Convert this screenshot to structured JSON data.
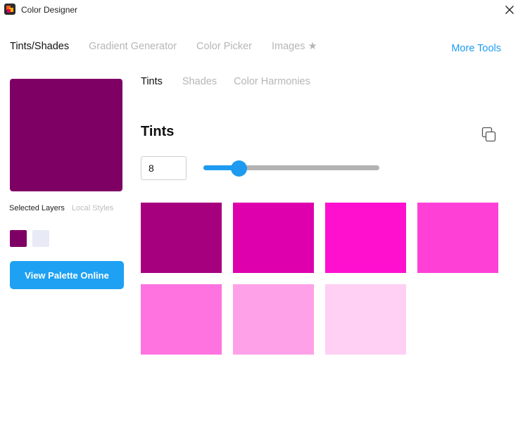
{
  "window": {
    "title": "Color Designer"
  },
  "top_tabs": [
    {
      "label": "Tints/Shades",
      "active": true
    },
    {
      "label": "Gradient Generator",
      "active": false
    },
    {
      "label": "Color Picker",
      "active": false
    },
    {
      "label": "Images ★",
      "active": false
    }
  ],
  "more_tools_label": "More Tools",
  "selected_color": "#7f0065",
  "layer_tabs": {
    "selected_layers": "Selected Layers",
    "local_styles": "Local Styles"
  },
  "layer_swatches": [
    "#7f0065",
    "#e8eaf6"
  ],
  "view_palette_label": "View Palette Online",
  "sub_tabs": [
    {
      "label": "Tints",
      "active": true
    },
    {
      "label": "Shades",
      "active": false
    },
    {
      "label": "Color Harmonies",
      "active": false
    }
  ],
  "section_title": "Tints",
  "tint_count": "8",
  "slider": {
    "fraction": 0.2
  },
  "tints": [
    "#a7007f",
    "#df00ad",
    "#ff10cf",
    "#ff40d6",
    "#ff73e0",
    "#ffa1e8",
    "#ffd0f3"
  ],
  "colors": {
    "accent": "#1e9bf0",
    "button": "#1ea1f2",
    "track": "#b3b3b3"
  },
  "icons": {
    "app": "app-logo-icon",
    "close": "close-icon",
    "copy": "copy-icon"
  }
}
